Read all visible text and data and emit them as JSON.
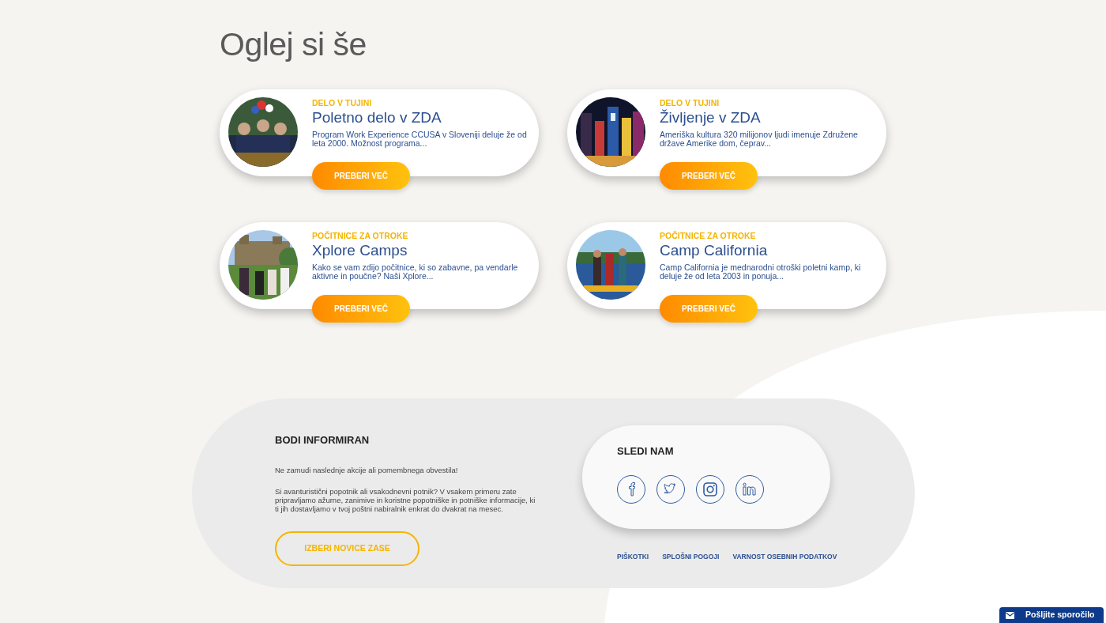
{
  "section_title": "Oglej si še",
  "articles": [
    {
      "category": "DELO V TUJINI",
      "title": "Poletno delo v ZDA",
      "excerpt": "Program Work Experience CCUSA v Sloveniji deluje že od leta 2000. Možnost programa...",
      "button": "PREBERI VEČ"
    },
    {
      "category": "DELO V TUJINI",
      "title": "Življenje v ZDA",
      "excerpt": "Ameriška kultura 320 milijonov ljudi imenuje Združene države Amerike dom, čeprav...",
      "button": "PREBERI VEČ"
    },
    {
      "category": "POČITNICE ZA OTROKE",
      "title": "Xplore Camps",
      "excerpt": "Kako se vam zdijo počitnice, ki so zabavne, pa vendarle aktivne in poučne? Naši Xplore...",
      "button": "PREBERI VEČ"
    },
    {
      "category": "POČITNICE ZA OTROKE",
      "title": "Camp California",
      "excerpt": "Camp California je mednarodni otroški poletni kamp, ki deluje že od leta 2003 in ponuja...",
      "button": "PREBERI VEČ"
    }
  ],
  "newsletter": {
    "title": "BODI INFORMIRAN",
    "lead": "Ne zamudi naslednje akcije ali pomembnega obvestila!",
    "text": "Si avanturistični popotnik ali vsakodnevni potnik? V vsakem primeru zate pripravljamo ažurne, zanimive in koristne popotniške in potniške informacije, ki ti jih dostavljamo v tvoj poštni nabiralnik enkrat do dvakrat na mesec.",
    "button": "IZBERI NOVICE ZASE"
  },
  "social": {
    "title": "SLEDI NAM",
    "links": [
      {
        "kind": "facebook"
      },
      {
        "kind": "twitter"
      },
      {
        "kind": "instagram"
      },
      {
        "kind": "linkedin"
      }
    ]
  },
  "footer_links": [
    "PIŠKOTKI",
    "SPLOŠNI POGOJI",
    "VARNOST OSEBNIH PODATKOV"
  ],
  "chat_button": {
    "label": "Pošljite sporočilo"
  }
}
